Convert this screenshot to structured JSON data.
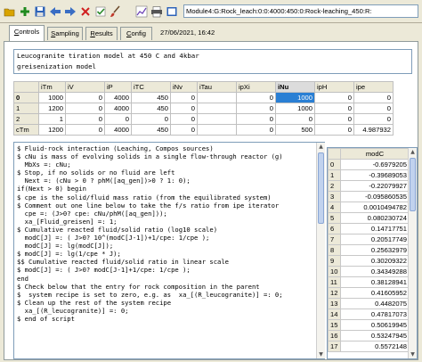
{
  "toolbar": {
    "buttons": [
      {
        "name": "open-folder-icon",
        "color": "#d9a400"
      },
      {
        "name": "add-icon",
        "color": "#1f8a1f"
      },
      {
        "name": "save-icon",
        "color": "#2e63b8"
      },
      {
        "name": "back-arrow-icon",
        "color": "#3a6ec4"
      },
      {
        "name": "forward-arrow-icon",
        "color": "#3a6ec4"
      },
      {
        "name": "delete-icon",
        "color": "#d02020"
      },
      {
        "name": "check-icon",
        "color": "#2a8a2a"
      },
      {
        "name": "brush-icon",
        "color": "#c0392b"
      },
      {
        "name": "graph-icon",
        "color": "#6a3fb5"
      },
      {
        "name": "print-icon",
        "color": "#555555"
      },
      {
        "name": "help-icon",
        "color": "#2e63b8"
      }
    ],
    "path": "Module4:G:Rock_leach:0:0:4000:450:0:Rock-leaching_450:R:"
  },
  "tabs": [
    {
      "label": "Controls",
      "accel": "C",
      "rest": "ontrols",
      "active": true
    },
    {
      "label": "Sampling",
      "accel": "S",
      "rest": "ampling",
      "active": false
    },
    {
      "label": "Results",
      "accel": "R",
      "rest": "esults",
      "active": false
    },
    {
      "label": "Config",
      "accel": "C",
      "rest": "onfig",
      "active": false
    }
  ],
  "timestamp": "27/06/2021, 16:42",
  "title_lines": [
    "Leucogranite tiration model at 450 C and 4kbar",
    "greisenization model"
  ],
  "grid": {
    "columns": [
      "",
      "iTm",
      "iV",
      "iP",
      "iTC",
      "iNv",
      "iTau",
      "ipXi",
      "iNu",
      "ipH",
      "ipe"
    ],
    "rows": [
      {
        "label": "0",
        "bold": true,
        "cells": [
          "1000",
          "0",
          "4000",
          "450",
          "0",
          "",
          "0",
          "1000",
          "0",
          "0"
        ]
      },
      {
        "label": "1",
        "bold": false,
        "cells": [
          "1200",
          "0",
          "4000",
          "450",
          "0",
          "",
          "0",
          "1000",
          "0",
          "0"
        ]
      },
      {
        "label": "2",
        "bold": false,
        "cells": [
          "1",
          "0",
          "0",
          "0",
          "0",
          "",
          "0",
          "0",
          "0",
          "0"
        ]
      },
      {
        "label": "cTm",
        "bold": false,
        "cells": [
          "1200",
          "0",
          "4000",
          "450",
          "0",
          "",
          "0",
          "500",
          "0",
          "4.987932"
        ]
      }
    ],
    "selected_column": "iNu",
    "highlight_color": "#2a7fd4"
  },
  "script_lines": [
    "$ Fluid-rock interaction (Leaching, Compos sources)",
    "$ cNu is mass of evolving solids in a single flow-through reactor (g)",
    "  MbXs =: cNu;",
    "$ Stop, if no solids or no fluid are left",
    "  Next =: (cNu > 0 ? phM([aq_gen])>0 ? 1: 0);",
    "if(Next > 0) begin",
    "$ cpe is the solid/fluid mass ratio (from the equilibrated system)",
    "$ Comment out one line below to take the f/s ratio from ipe iterator",
    "  cpe =: (J>0? cpe: cNu/phM([aq_gen]));",
    "  xa_[Fluid_greisen] =: 1;",
    "$ Cumulative reacted fluid/solid ratio (log10 scale)",
    "  modC[J] =: ( J>0? 10^(modC[J-1])+1/cpe: 1/cpe );",
    "  modC[J] =: lg(modC[J]);",
    "$ modC[J] =: lg(1/cpe * J);",
    "$$ Cumulative reacted fluid/solid ratio in linear scale",
    "$ modC[J] =: ( J>0? modC[J-1]+1/cpe: 1/cpe );",
    "end",
    "$ Check below that the entry for rock composition in the parent",
    "$  system recipe is set to zero, e.g. as  xa_[(R_leucogranite)] =: 0;",
    "$ Clean up the rest of the system recipe",
    "  xa_[(R_leucogranite)] =: 0;",
    "$ end of script"
  ],
  "modc": {
    "header": "modC",
    "rows": [
      {
        "i": "0",
        "v": "-0.6979205"
      },
      {
        "i": "1",
        "v": "-0.39689053"
      },
      {
        "i": "2",
        "v": "-0.22079927"
      },
      {
        "i": "3",
        "v": "-0.095860535"
      },
      {
        "i": "4",
        "v": "0.0010494782"
      },
      {
        "i": "5",
        "v": "0.080230724"
      },
      {
        "i": "6",
        "v": "0.14717751"
      },
      {
        "i": "7",
        "v": "0.20517749"
      },
      {
        "i": "8",
        "v": "0.25632979"
      },
      {
        "i": "9",
        "v": "0.30209322"
      },
      {
        "i": "10",
        "v": "0.34349288"
      },
      {
        "i": "11",
        "v": "0.38128941"
      },
      {
        "i": "12",
        "v": "0.41605952"
      },
      {
        "i": "13",
        "v": "0.4482075"
      },
      {
        "i": "14",
        "v": "0.47817073"
      },
      {
        "i": "15",
        "v": "0.50619945"
      },
      {
        "i": "16",
        "v": "0.53247945"
      },
      {
        "i": "17",
        "v": "0.5572148"
      }
    ]
  }
}
